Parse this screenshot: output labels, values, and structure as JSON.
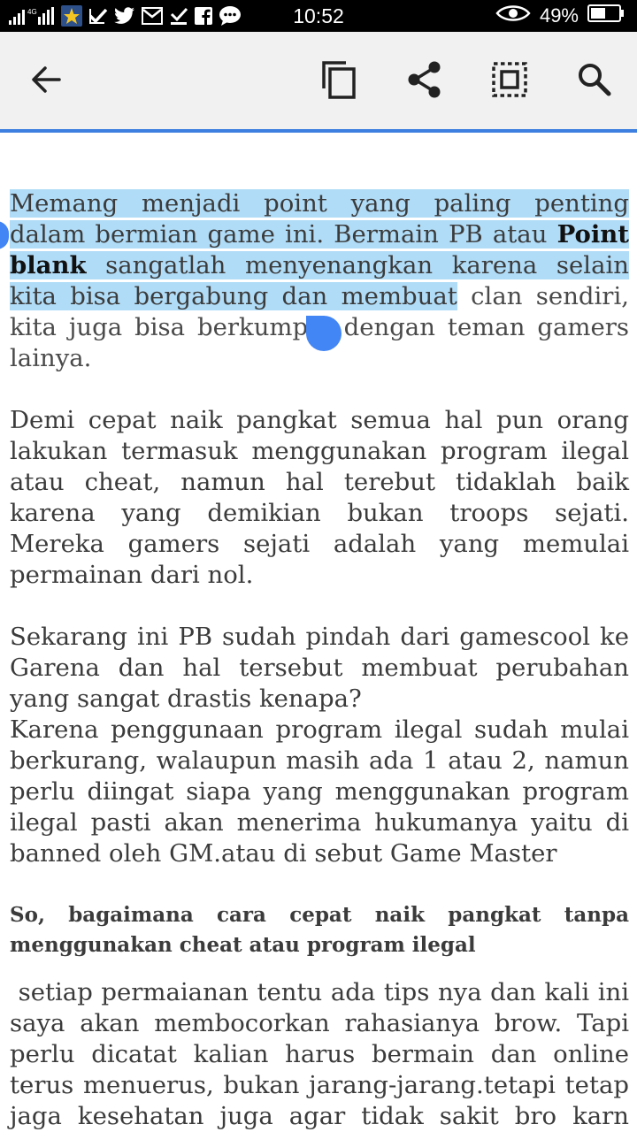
{
  "status_bar": {
    "network": "4G",
    "time": "10:52",
    "battery": "49%",
    "icons": [
      "signal-icon",
      "app-icon",
      "check-icon",
      "twitter-icon",
      "gmail-icon",
      "download-icon",
      "facebook-icon",
      "chat-icon",
      "eye-icon",
      "battery-icon"
    ]
  },
  "toolbar": {
    "icons": [
      "back-arrow-icon",
      "copy-icon",
      "share-icon",
      "select-all-icon",
      "search-icon"
    ]
  },
  "colors": {
    "selection": "#b0dcf7",
    "handle": "#4285f4",
    "accent_line": "#3d7fe0"
  },
  "article": {
    "p1_sel_a": "Memang menjadi point yang paling penting dalam bermian game ini. Bermain PB atau ",
    "p1_sel_bold": "Point blank",
    "p1_sel_b": " sangatlah menyenangkan karena selain kita bisa bergabung dan membuat",
    "p1_rest": " clan sendiri, kita juga bisa berkumpul dengan teman gamers lainya.",
    "p2": "Demi cepat naik pangkat semua hal pun orang lakukan termasuk menggunakan program ilegal atau cheat, namun hal terebut tidaklah baik karena yang demikian bukan troops sejati. Mereka gamers sejati adalah yang memulai permainan dari nol.",
    "p3": "Sekarang ini PB sudah pindah dari gamescool ke Garena dan hal tersebut membuat perubahan yang sangat drastis kenapa?",
    "p4": "Karena penggunaan program ilegal sudah mulai berkurang, walaupun masih ada 1 atau 2, namun perlu diingat siapa yang menggunakan program ilegal pasti akan menerima hukumanya yaitu di banned oleh GM.atau di sebut Game Master",
    "heading": "So, bagaimana cara cepat naik pangkat tanpa menggunakan cheat atau program ilegal",
    "p5": " setiap permaianan tentu ada tips nya dan kali ini saya akan membocorkan rahasianya brow. Tapi perlu dicatat kalian harus bermain dan online terus menuerus, bukan jarang-jarang.tetapi tetap jaga kesehatan juga agar tidak sakit bro karn akesehatan lebih dari segalanya"
  }
}
